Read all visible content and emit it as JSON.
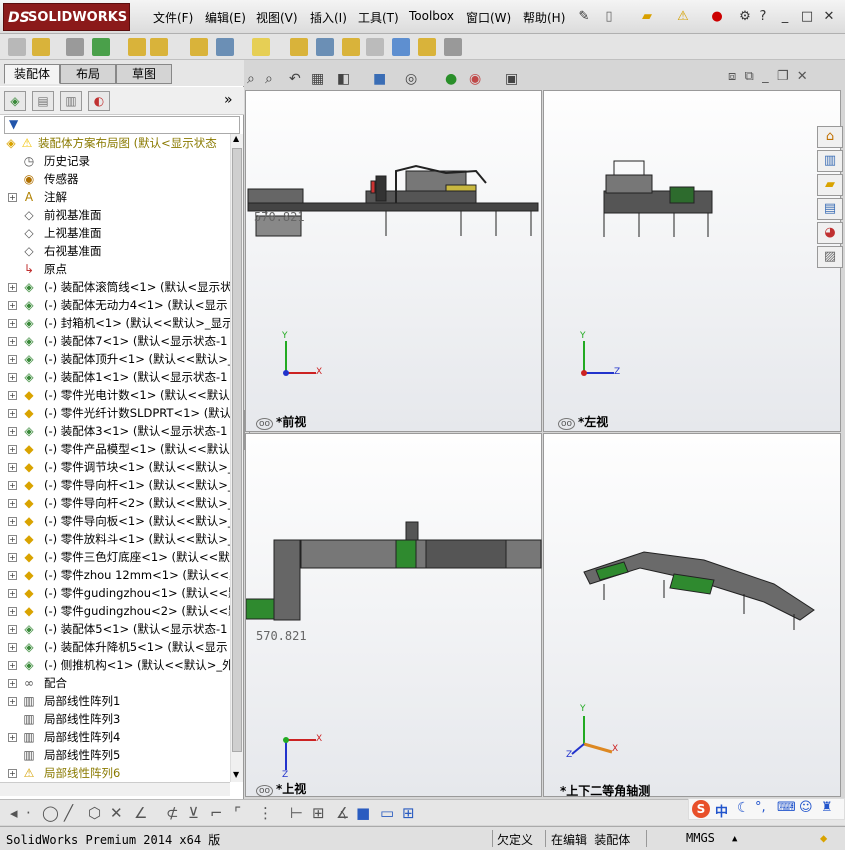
{
  "app": {
    "logo_text": "SOLIDWORKS",
    "logo_ds": "DS"
  },
  "menu": [
    "文件(F)",
    "编辑(E)",
    "视图(V)",
    "插入(I)",
    "工具(T)",
    "Toolbox",
    "窗口(W)",
    "帮助(H)"
  ],
  "window_icons": {
    "pin": "pin-icon",
    "help": "?",
    "minimize": "_",
    "restore": "□",
    "close": "✕"
  },
  "panel_tabs": [
    "装配体",
    "布局",
    "草图"
  ],
  "panel_expand": "»",
  "tree": [
    {
      "label": "装配体方案布局图  (默认<显示状态",
      "icon": "assembly-warning",
      "kind": "root",
      "expand": ""
    },
    {
      "label": "历史记录",
      "icon": "history",
      "kind": "item",
      "expand": ""
    },
    {
      "label": "传感器",
      "icon": "sensor",
      "kind": "item",
      "expand": ""
    },
    {
      "label": "注解",
      "icon": "annotation",
      "kind": "item",
      "expand": "+"
    },
    {
      "label": "前视基准面",
      "icon": "plane",
      "kind": "item",
      "expand": ""
    },
    {
      "label": "上视基准面",
      "icon": "plane",
      "kind": "item",
      "expand": ""
    },
    {
      "label": "右视基准面",
      "icon": "plane",
      "kind": "item",
      "expand": ""
    },
    {
      "label": "原点",
      "icon": "origin",
      "kind": "item",
      "expand": ""
    },
    {
      "label": "(-) 装配体滚筒线<1> (默认<显示状",
      "icon": "assembly",
      "kind": "item",
      "expand": "+"
    },
    {
      "label": "(-) 装配体无动力4<1> (默认<显示",
      "icon": "assembly",
      "kind": "item",
      "expand": "+"
    },
    {
      "label": "(-) 封箱机<1> (默认<<默认>_显示",
      "icon": "assembly",
      "kind": "item",
      "expand": "+"
    },
    {
      "label": "(-) 装配体7<1> (默认<显示状态-1",
      "icon": "assembly",
      "kind": "item",
      "expand": "+"
    },
    {
      "label": "(-) 装配体顶升<1> (默认<<默认>_",
      "icon": "assembly",
      "kind": "item",
      "expand": "+"
    },
    {
      "label": "(-) 装配体1<1> (默认<显示状态-1",
      "icon": "assembly",
      "kind": "item",
      "expand": "+"
    },
    {
      "label": "(-) 零件光电计数<1> (默认<<默认",
      "icon": "part",
      "kind": "item",
      "expand": "+"
    },
    {
      "label": "(-) 零件光纤计数SLDPRT<1> (默认",
      "icon": "part",
      "kind": "item",
      "expand": "+"
    },
    {
      "label": "(-) 装配体3<1> (默认<显示状态-1",
      "icon": "assembly",
      "kind": "item",
      "expand": "+"
    },
    {
      "label": "(-) 零件产品模型<1> (默认<<默认",
      "icon": "part",
      "kind": "item",
      "expand": "+"
    },
    {
      "label": "(-) 零件调节块<1> (默认<<默认>_",
      "icon": "part",
      "kind": "item",
      "expand": "+"
    },
    {
      "label": "(-) 零件导向杆<1> (默认<<默认>_",
      "icon": "part",
      "kind": "item",
      "expand": "+"
    },
    {
      "label": "(-) 零件导向杆<2> (默认<<默认>_",
      "icon": "part",
      "kind": "item",
      "expand": "+"
    },
    {
      "label": "(-) 零件导向板<1> (默认<<默认>_",
      "icon": "part",
      "kind": "item",
      "expand": "+"
    },
    {
      "label": "(-) 零件放料斗<1> (默认<<默认>_",
      "icon": "part",
      "kind": "item",
      "expand": "+"
    },
    {
      "label": "(-) 零件三色灯底座<1> (默认<<默",
      "icon": "part",
      "kind": "item",
      "expand": "+"
    },
    {
      "label": "(-) 零件zhou 12mm<1> (默认<<默",
      "icon": "part",
      "kind": "item",
      "expand": "+"
    },
    {
      "label": "(-) 零件gudingzhou<1> (默认<<默",
      "icon": "part",
      "kind": "item",
      "expand": "+"
    },
    {
      "label": "(-) 零件gudingzhou<2> (默认<<默",
      "icon": "part",
      "kind": "item",
      "expand": "+"
    },
    {
      "label": "(-) 装配体5<1> (默认<显示状态-1",
      "icon": "assembly",
      "kind": "item",
      "expand": "+"
    },
    {
      "label": "(-) 装配体升降机5<1> (默认<显示",
      "icon": "assembly",
      "kind": "item",
      "expand": "+"
    },
    {
      "label": "(-) 侧推机构<1> (默认<<默认>_外",
      "icon": "assembly",
      "kind": "item",
      "expand": "+"
    },
    {
      "label": "配合",
      "icon": "mates",
      "kind": "item",
      "expand": "+"
    },
    {
      "label": "局部线性阵列1",
      "icon": "pattern",
      "kind": "item",
      "expand": "+"
    },
    {
      "label": "局部线性阵列3",
      "icon": "pattern",
      "kind": "item",
      "expand": ""
    },
    {
      "label": "局部线性阵列4",
      "icon": "pattern",
      "kind": "item",
      "expand": "+"
    },
    {
      "label": "局部线性阵列5",
      "icon": "pattern",
      "kind": "item",
      "expand": ""
    },
    {
      "label": "局部线性阵列6",
      "icon": "pattern-warning",
      "kind": "warn",
      "expand": "+"
    }
  ],
  "viewports": [
    {
      "label": "*前视",
      "axes": [
        "Y",
        "X"
      ]
    },
    {
      "label": "*左视",
      "axes": [
        "Y",
        "Z"
      ]
    },
    {
      "label": "*上视",
      "axes": [
        "X",
        "Z"
      ]
    },
    {
      "label": "*上下二等角轴测",
      "axes": [
        "Y",
        "X",
        "Z"
      ]
    }
  ],
  "scale_text": "570.821",
  "status": {
    "app_version": "SolidWorks Premium 2014 x64 版",
    "underdefined": "欠定义",
    "editing": "在编辑 装配体",
    "units": "MMGS",
    "units_arrow": "▲"
  },
  "ime": {
    "logo": "S",
    "lang": "中"
  },
  "colors": {
    "brand": "#8b1a1a",
    "warning": "#f2c200",
    "tree_warn_text": "#8a7a00",
    "axis_x": "#cc2222",
    "axis_y": "#22aa22",
    "axis_z": "#2233cc"
  }
}
